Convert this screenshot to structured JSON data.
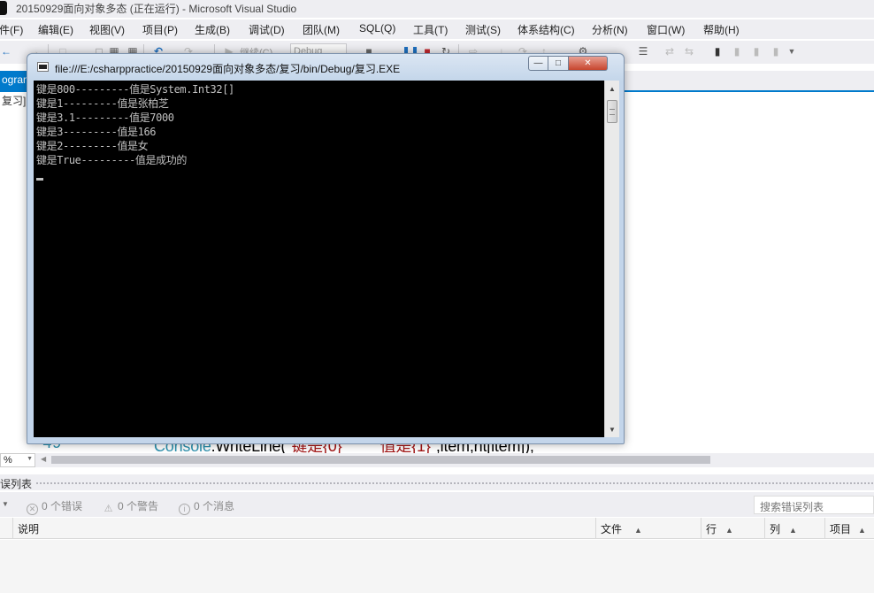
{
  "vs": {
    "title": "20150929面向对象多态 (正在运行) - Microsoft Visual Studio",
    "menu": [
      "件(F)",
      "编辑(E)",
      "视图(V)",
      "项目(P)",
      "生成(B)",
      "调试(D)",
      "团队(M)",
      "SQL(Q)",
      "工具(T)",
      "测试(S)",
      "体系结构(C)",
      "分析(N)",
      "窗口(W)",
      "帮助(H)"
    ],
    "toolbar": {
      "continue_label": "继续(C)",
      "config_label": "Debug"
    },
    "editor_tab": "ogram",
    "file_tab": "复习]",
    "line_number": "49",
    "code": {
      "prefix": "Console",
      "method": ".WriteLine(",
      "str1": "\"键是{0}",
      "gap": "         ",
      "str2": "值是{1}\"",
      "rest": ",item,ht[item]);"
    },
    "zoom": "%"
  },
  "console": {
    "title": "file:///E:/csharppractice/20150929面向对象多态/复习/bin/Debug/复习.EXE",
    "lines": [
      "键是800---------值是System.Int32[]",
      "键是1---------值是张柏芝",
      "键是3.1---------值是7000",
      "键是3---------值是166",
      "键是2---------值是女",
      "键是True---------值是成功的"
    ]
  },
  "error_list": {
    "title": "误列表",
    "errors": "0 个错误",
    "warnings": "0 个警告",
    "messages": "0 个消息",
    "search_placeholder": "搜索错误列表",
    "columns": [
      "说明",
      "文件",
      "行",
      "列",
      "项目"
    ]
  },
  "colors": {
    "accent": "#007acc",
    "console_bg": "#000000",
    "console_text": "#c0c0c0"
  }
}
